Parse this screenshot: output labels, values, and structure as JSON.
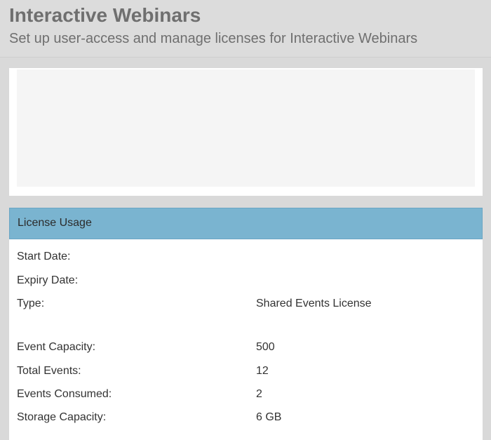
{
  "header": {
    "title": "Interactive Webinars",
    "subtitle": "Set up user-access and manage licenses for Interactive Webinars"
  },
  "license": {
    "title": "License Usage",
    "rows": [
      {
        "label": "Start Date:",
        "value": ""
      },
      {
        "label": "Expiry Date:",
        "value": ""
      },
      {
        "label": "Type:",
        "value": "Shared Events License"
      },
      {
        "label": "Event Capacity:",
        "value": "500"
      },
      {
        "label": "Total Events:",
        "value": "12"
      },
      {
        "label": "Events Consumed:",
        "value": "2"
      },
      {
        "label": "Storage Capacity:",
        "value": "6 GB"
      }
    ]
  }
}
